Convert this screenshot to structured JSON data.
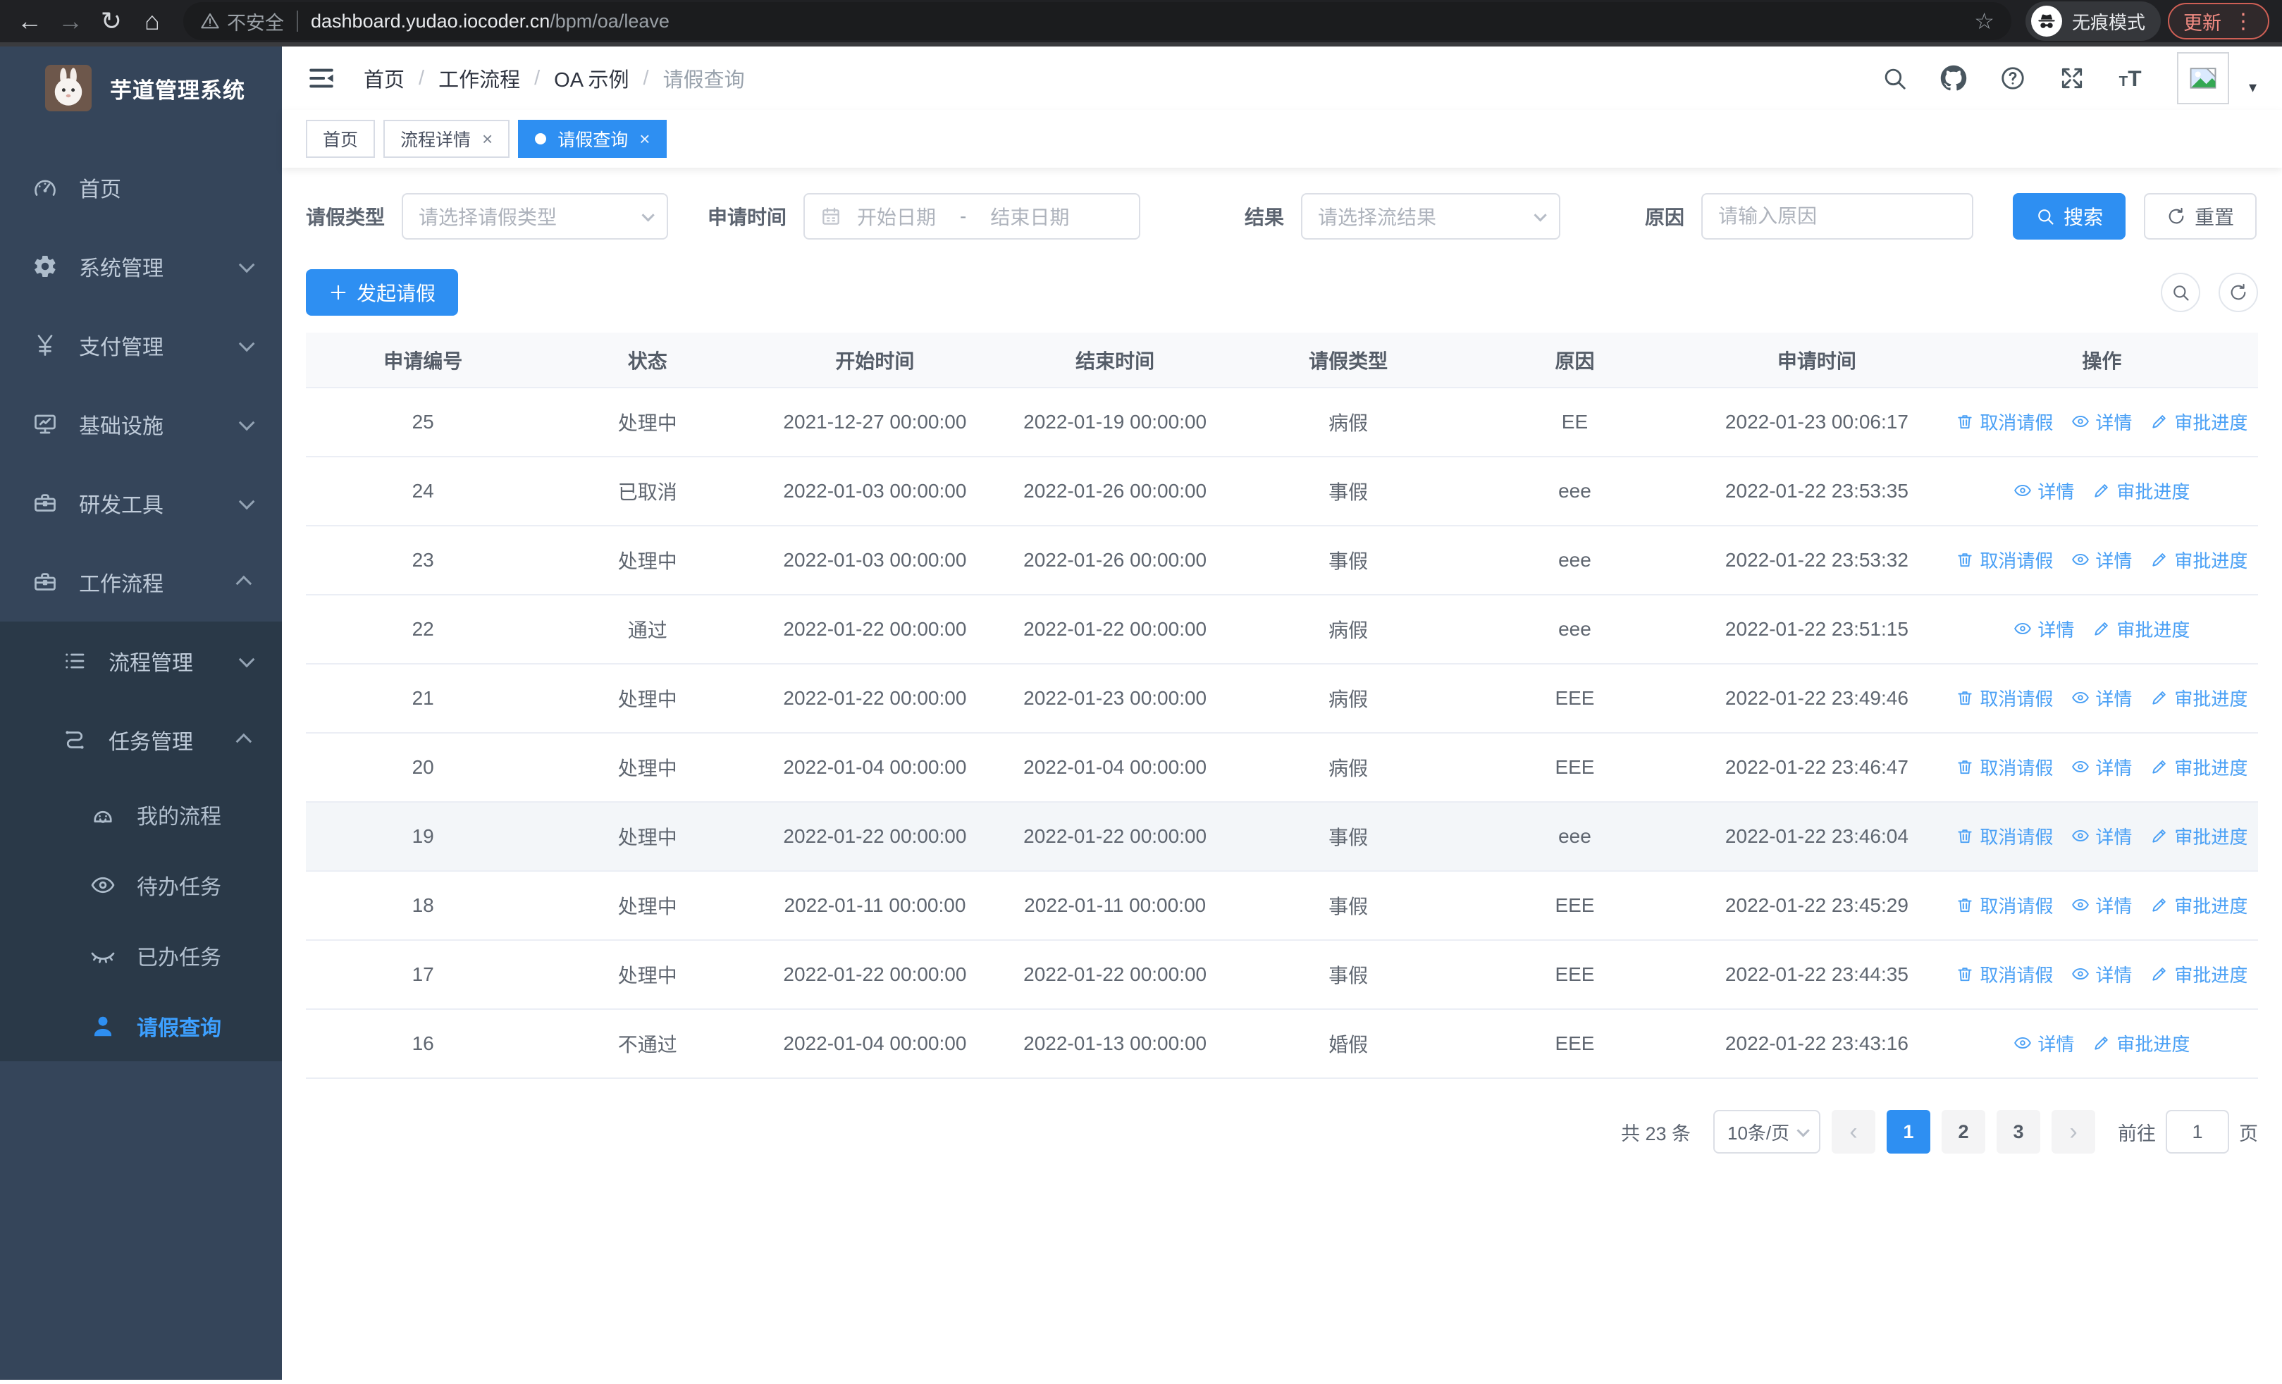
{
  "browser": {
    "security_label": "不安全",
    "url_host": "dashboard.yudao.iocoder.cn",
    "url_path": "/bpm/oa/leave",
    "incognito_label": "无痕模式",
    "update_label": "更新"
  },
  "glyphs": {
    "back": "←",
    "forward": "→",
    "reload": "↻",
    "home": "⌂",
    "star": "☆",
    "menu_dots": "⋮",
    "close": "×",
    "caret_down": "▾",
    "prev": "‹",
    "next": "›"
  },
  "sidebar": {
    "title": "芋道管理系统",
    "items": [
      {
        "label": "首页"
      },
      {
        "label": "系统管理"
      },
      {
        "label": "支付管理"
      },
      {
        "label": "基础设施"
      },
      {
        "label": "研发工具"
      },
      {
        "label": "工作流程"
      },
      {
        "label": "流程管理"
      },
      {
        "label": "任务管理"
      },
      {
        "label": "我的流程"
      },
      {
        "label": "待办任务"
      },
      {
        "label": "已办任务"
      },
      {
        "label": "请假查询"
      }
    ]
  },
  "header": {
    "separator": "/",
    "breadcrumb": [
      {
        "label": "首页"
      },
      {
        "label": "工作流程"
      },
      {
        "label": "OA 示例"
      },
      {
        "label": "请假查询"
      }
    ]
  },
  "tabs": [
    {
      "label": "首页"
    },
    {
      "label": "流程详情"
    },
    {
      "label": "请假查询"
    }
  ],
  "filters": {
    "leave_type_label": "请假类型",
    "leave_type_placeholder": "请选择请假类型",
    "apply_time_label": "申请时间",
    "date_start_placeholder": "开始日期",
    "date_separator": "-",
    "date_end_placeholder": "结束日期",
    "result_label": "结果",
    "result_placeholder": "请选择流结果",
    "reason_label": "原因",
    "reason_placeholder": "请输入原因",
    "search_label": "搜索",
    "reset_label": "重置"
  },
  "toolbar": {
    "create_label": "发起请假"
  },
  "table": {
    "columns": [
      "申请编号",
      "状态",
      "开始时间",
      "结束时间",
      "请假类型",
      "原因",
      "申请时间",
      "操作"
    ],
    "action_labels": {
      "cancel": "取消请假",
      "detail": "详情",
      "progress": "审批进度"
    },
    "rows": [
      {
        "id": "25",
        "status": "处理中",
        "start": "2021-12-27 00:00:00",
        "end": "2022-01-19 00:00:00",
        "type": "病假",
        "reason": "EE",
        "applied": "2022-01-23 00:06:17",
        "actions": [
          "cancel",
          "detail",
          "progress"
        ],
        "highlight": false
      },
      {
        "id": "24",
        "status": "已取消",
        "start": "2022-01-03 00:00:00",
        "end": "2022-01-26 00:00:00",
        "type": "事假",
        "reason": "eee",
        "applied": "2022-01-22 23:53:35",
        "actions": [
          "detail",
          "progress"
        ],
        "highlight": false
      },
      {
        "id": "23",
        "status": "处理中",
        "start": "2022-01-03 00:00:00",
        "end": "2022-01-26 00:00:00",
        "type": "事假",
        "reason": "eee",
        "applied": "2022-01-22 23:53:32",
        "actions": [
          "cancel",
          "detail",
          "progress"
        ],
        "highlight": false
      },
      {
        "id": "22",
        "status": "通过",
        "start": "2022-01-22 00:00:00",
        "end": "2022-01-22 00:00:00",
        "type": "病假",
        "reason": "eee",
        "applied": "2022-01-22 23:51:15",
        "actions": [
          "detail",
          "progress"
        ],
        "highlight": false
      },
      {
        "id": "21",
        "status": "处理中",
        "start": "2022-01-22 00:00:00",
        "end": "2022-01-23 00:00:00",
        "type": "病假",
        "reason": "EEE",
        "applied": "2022-01-22 23:49:46",
        "actions": [
          "cancel",
          "detail",
          "progress"
        ],
        "highlight": false
      },
      {
        "id": "20",
        "status": "处理中",
        "start": "2022-01-04 00:00:00",
        "end": "2022-01-04 00:00:00",
        "type": "病假",
        "reason": "EEE",
        "applied": "2022-01-22 23:46:47",
        "actions": [
          "cancel",
          "detail",
          "progress"
        ],
        "highlight": false
      },
      {
        "id": "19",
        "status": "处理中",
        "start": "2022-01-22 00:00:00",
        "end": "2022-01-22 00:00:00",
        "type": "事假",
        "reason": "eee",
        "applied": "2022-01-22 23:46:04",
        "actions": [
          "cancel",
          "detail",
          "progress"
        ],
        "highlight": true
      },
      {
        "id": "18",
        "status": "处理中",
        "start": "2022-01-11 00:00:00",
        "end": "2022-01-11 00:00:00",
        "type": "事假",
        "reason": "EEE",
        "applied": "2022-01-22 23:45:29",
        "actions": [
          "cancel",
          "detail",
          "progress"
        ],
        "highlight": false
      },
      {
        "id": "17",
        "status": "处理中",
        "start": "2022-01-22 00:00:00",
        "end": "2022-01-22 00:00:00",
        "type": "事假",
        "reason": "EEE",
        "applied": "2022-01-22 23:44:35",
        "actions": [
          "cancel",
          "detail",
          "progress"
        ],
        "highlight": false
      },
      {
        "id": "16",
        "status": "不通过",
        "start": "2022-01-04 00:00:00",
        "end": "2022-01-13 00:00:00",
        "type": "婚假",
        "reason": "EEE",
        "applied": "2022-01-22 23:43:16",
        "actions": [
          "detail",
          "progress"
        ],
        "highlight": false
      }
    ]
  },
  "pagination": {
    "total_label": "共 23 条",
    "page_size_value": "10条/页",
    "pages": [
      "1",
      "2",
      "3"
    ],
    "active_page": "1",
    "goto_label": "前往",
    "goto_value": "1",
    "page_suffix": "页"
  },
  "colors": {
    "accent": "#2e8ff2",
    "link": "#4aa0f5",
    "sidebar_bg": "#35455a",
    "submenu_bg": "#2a3948",
    "active_menu_text": "#3da0ff",
    "chrome_bg": "#202124",
    "update_text": "#f28b82"
  }
}
